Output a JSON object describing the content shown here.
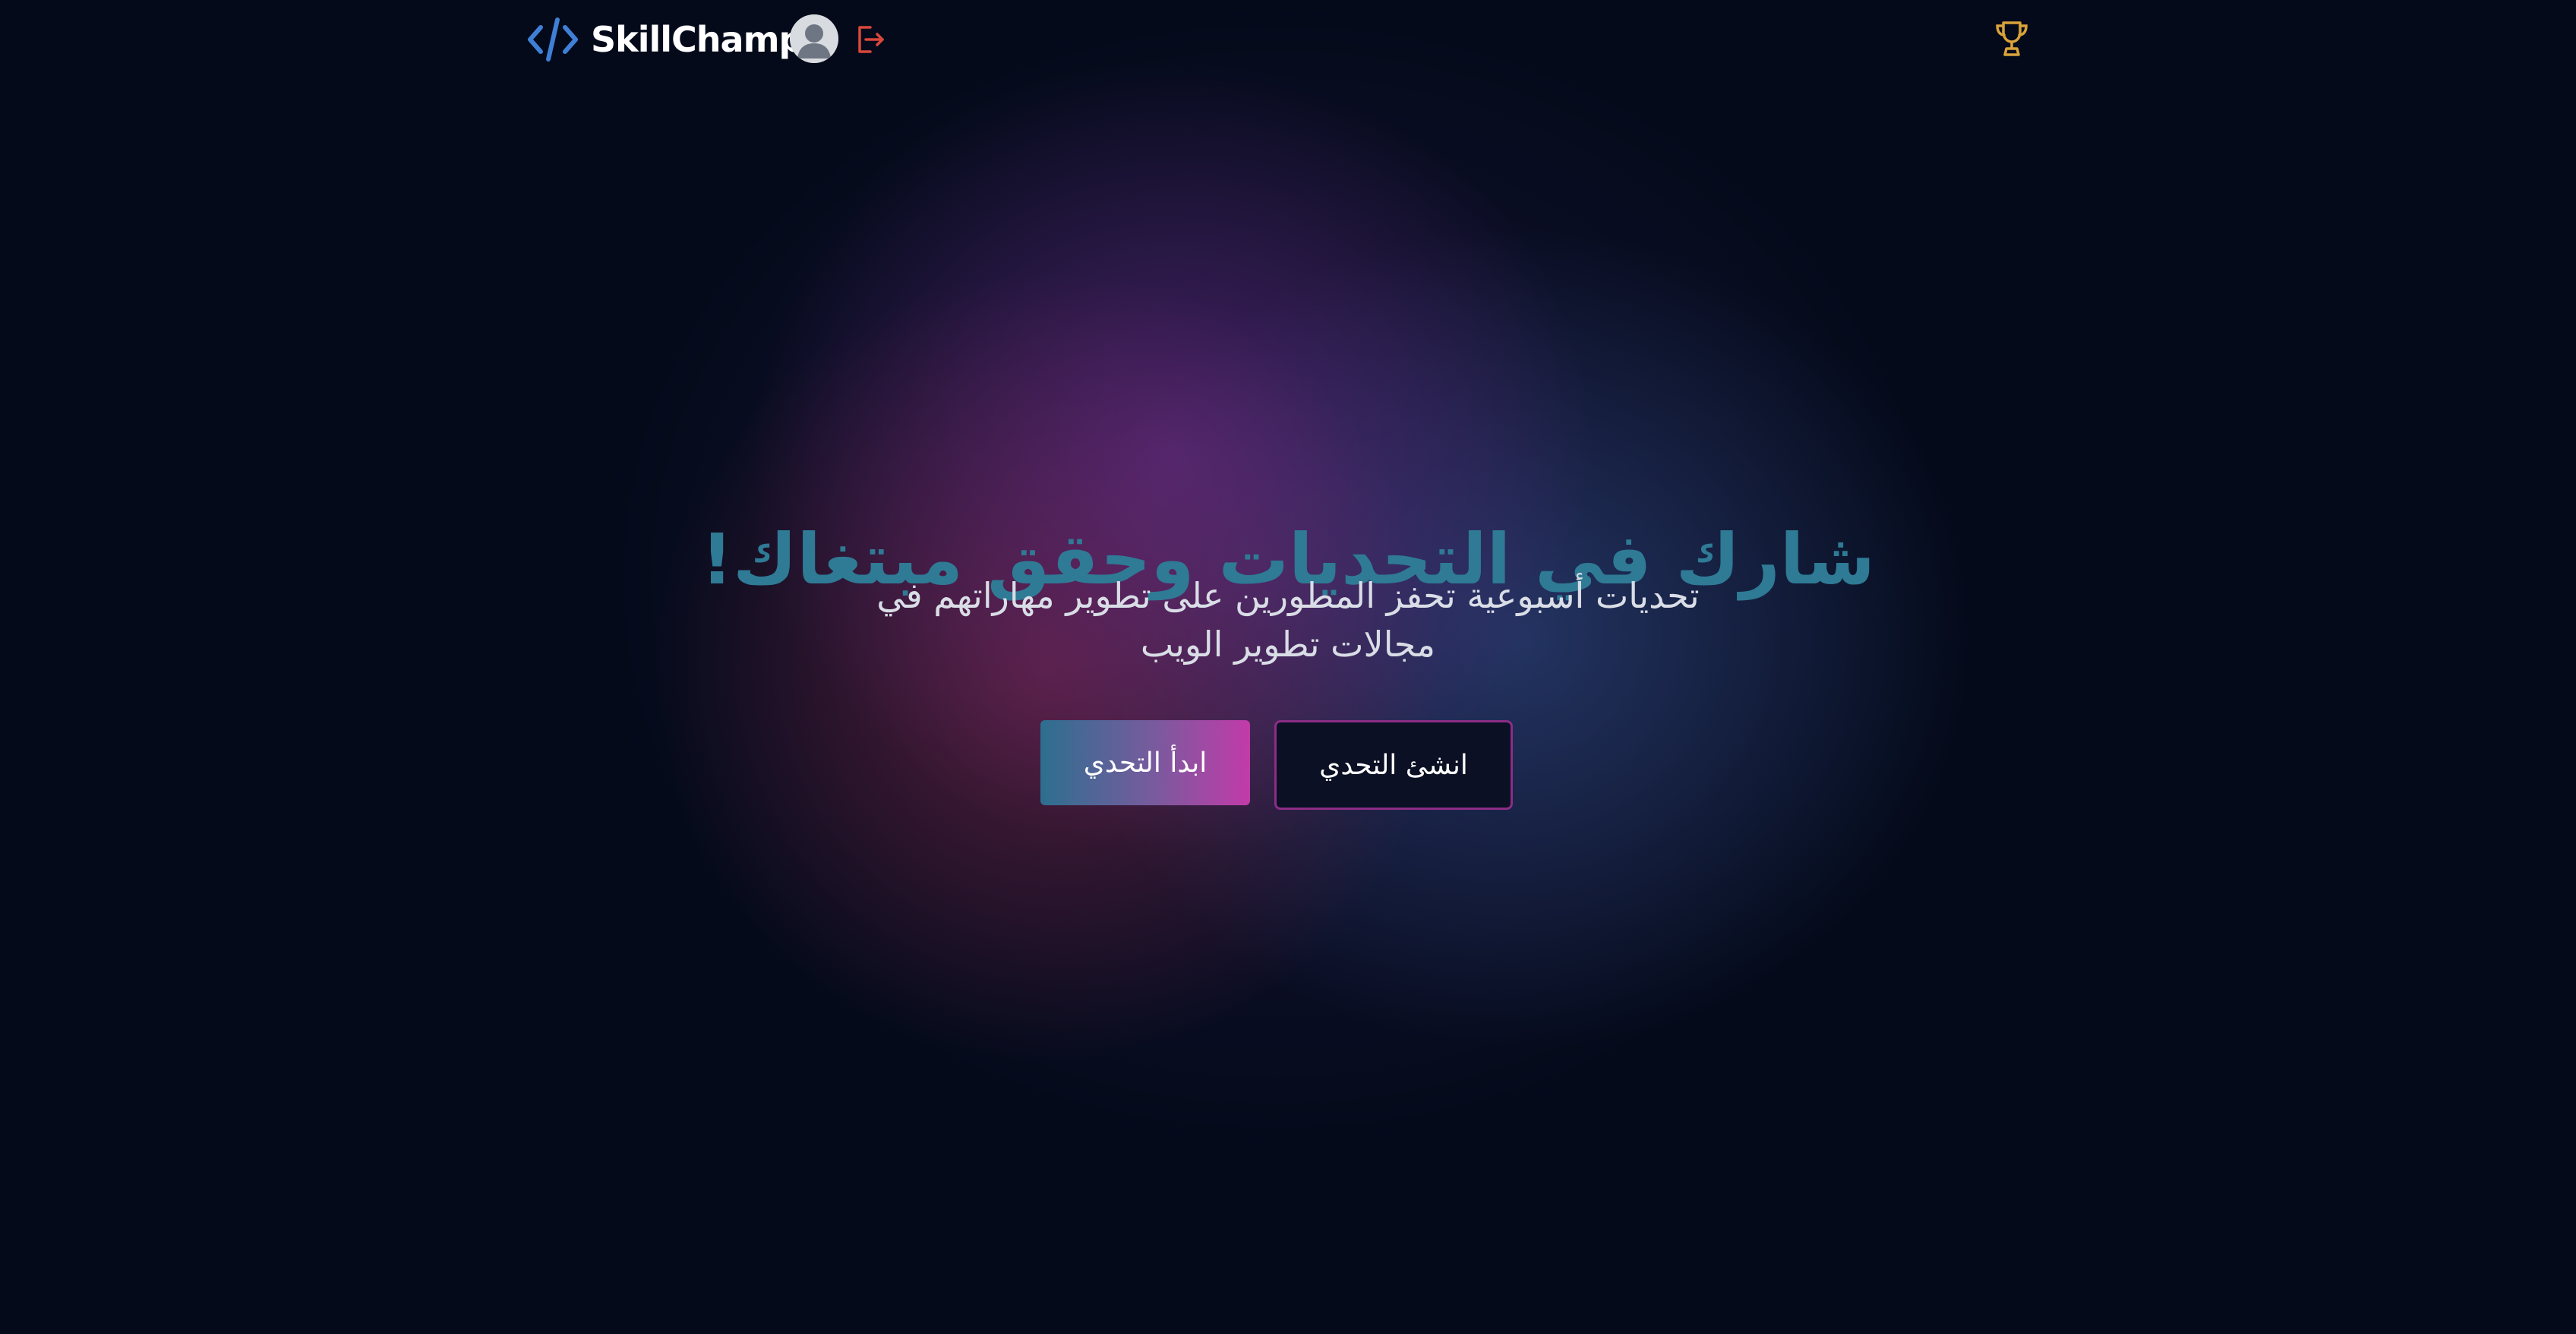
{
  "header": {
    "brand": "SkillChamp",
    "logo_icon": "code-icon",
    "avatar_icon": "user-avatar-icon",
    "logout_icon": "logout-icon",
    "trophy_icon": "trophy-icon"
  },
  "hero": {
    "title": "شارك في التحديات وحقق مبتغاك!",
    "subtitle_line1": "تحديات أسبوعية تحفز المطورين على تطوير مهاراتهم في",
    "subtitle_line2": "مجالات تطوير الويب",
    "start_button": "ابدأ التحدي",
    "create_button": "انشئ التحدي"
  },
  "colors": {
    "background": "#040a1a",
    "title": "#2f7a95",
    "accent_blue": "#3f7fd6",
    "accent_pink": "#c23ba9",
    "logout_red": "#d9483b",
    "trophy_gold": "#d9a33a"
  }
}
